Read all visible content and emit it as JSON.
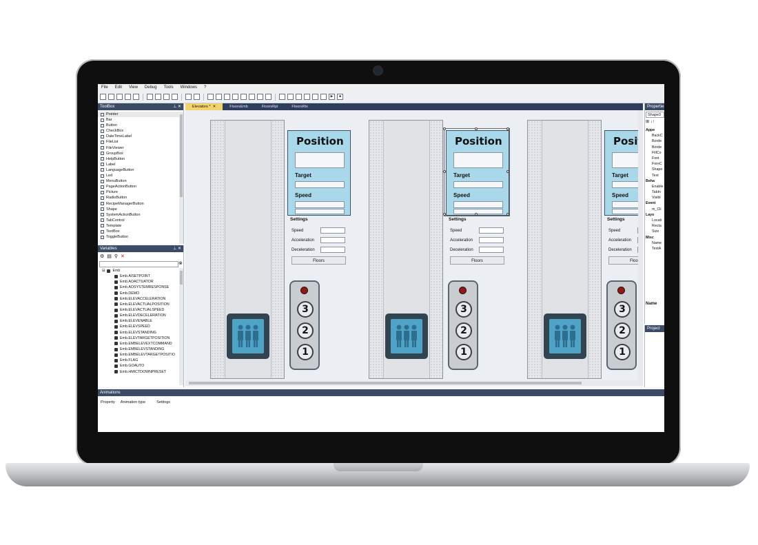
{
  "menu": [
    "File",
    "Edit",
    "View",
    "Debug",
    "Tools",
    "Windows",
    "?"
  ],
  "toolbox": {
    "title": "ToolBox",
    "items": [
      "Pointer",
      "Bar",
      "Button",
      "CheckBox",
      "DateTimeLabel",
      "FileList",
      "FileViewer",
      "GroupBox",
      "HelpButton",
      "Label",
      "LanguageButton",
      "Led",
      "MenuButton",
      "PageActionButton",
      "Picture",
      "RadioButton",
      "RecipeManagerButton",
      "Shape",
      "SystemActionButton",
      "TabControl",
      "Template",
      "TextBox",
      "ToggleButton"
    ]
  },
  "variables": {
    "title": "Variables",
    "root": "Emb",
    "items": [
      "Emb.AISETPOINT",
      "Emb.AOACTUATOR",
      "Emb.AOSYSTEMRESPONSE",
      "Emb.DEMO",
      "Emb.ELEVACCELERATION",
      "Emb.ELEVACTUALPOSITION",
      "Emb.ELEVACTUALSPEED",
      "Emb.ELEVDECELERATION",
      "Emb.ELEVENABLE",
      "Emb.ELEVSPEED",
      "Emb.ELEVSTANDING",
      "Emb.ELEVTARGETPOSITION",
      "Emb.EMBELEVEXTCOMMAND",
      "Emb.EMBELEVSTANDING",
      "Emb.EMBELEVTARGETPOSITIO",
      "Emb.FLAG",
      "Emb.GOAUTO",
      "Emb.HMICTDOWNPRESET"
    ]
  },
  "tabs": [
    {
      "label": "Elevators *"
    },
    {
      "label": "FloorsEmb"
    },
    {
      "label": "FloorsRpi"
    },
    {
      "label": "FloorsRtx"
    }
  ],
  "elevator": {
    "position_title": "Position",
    "target_label": "Target",
    "speed_label": "Speed",
    "settings_title": "Settings",
    "settings_speed": "Speed",
    "settings_acceleration": "Acceleration",
    "settings_deceleration": "Deceleration",
    "floors_button": "Floors",
    "floor_buttons": [
      "3",
      "2",
      "1"
    ]
  },
  "properties": {
    "title": "Properties",
    "object": "Shape3",
    "items": [
      {
        "label": "Appe",
        "cat": true
      },
      {
        "label": "BackC"
      },
      {
        "label": "Borde"
      },
      {
        "label": "Borde"
      },
      {
        "label": "FillCo"
      },
      {
        "label": "Font"
      },
      {
        "label": "ForeC"
      },
      {
        "label": "Shape"
      },
      {
        "label": "Text"
      },
      {
        "label": "Beha",
        "cat": true
      },
      {
        "label": "Enable"
      },
      {
        "label": "TabIn"
      },
      {
        "label": "Visibl"
      },
      {
        "label": "Event",
        "cat": true
      },
      {
        "label": "m_Cli"
      },
      {
        "label": "Layo",
        "cat": true
      },
      {
        "label": "Locati"
      },
      {
        "label": "Recta"
      },
      {
        "label": "Size"
      },
      {
        "label": "Misc",
        "cat": true
      },
      {
        "label": "Name"
      },
      {
        "label": "TextA"
      }
    ],
    "footer_name": "Name"
  },
  "project": {
    "title": "Project"
  },
  "animations": {
    "title": "Animations",
    "columns": [
      "Property",
      "Animation type",
      "Settings"
    ]
  }
}
